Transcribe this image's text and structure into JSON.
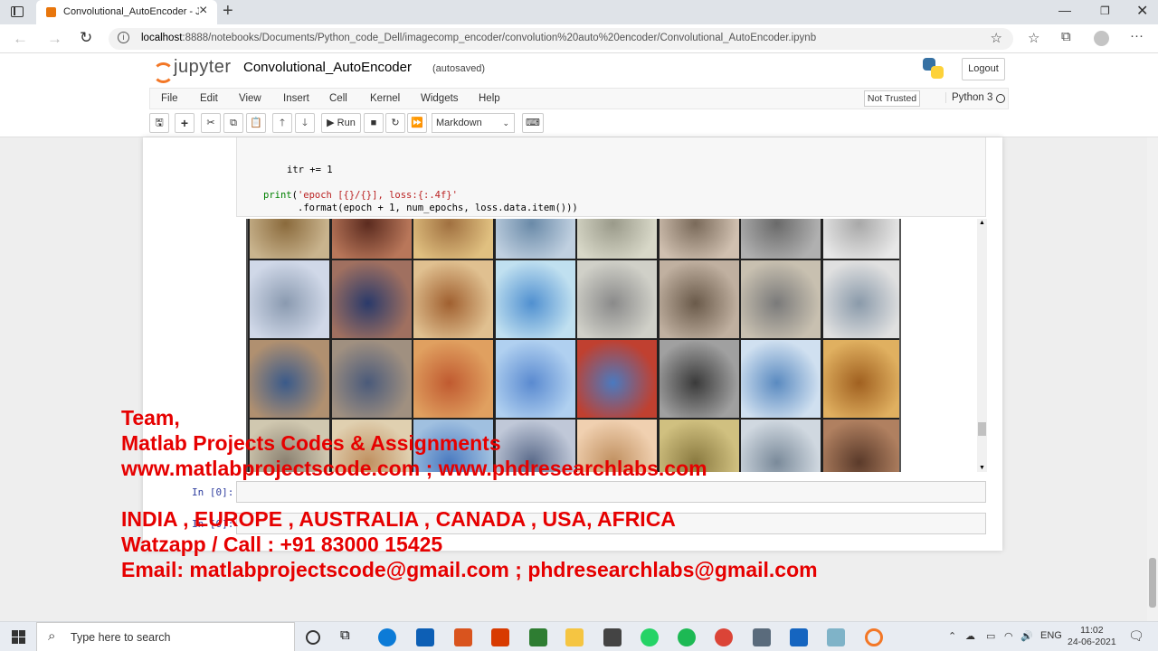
{
  "browser": {
    "tab_title": "Convolutional_AutoEncoder - Ju",
    "url_host": "localhost",
    "url_rest": ":8888/notebooks/Documents/Python_code_Dell/imagecomp_encoder/convolution%20auto%20encoder/Convolutional_AutoEncoder.ipynb"
  },
  "jupyter": {
    "logo_text": "jupyter",
    "notebook_name": "Convolutional_AutoEncoder",
    "save_status": "(autosaved)",
    "logout_label": "Logout",
    "menu": [
      "File",
      "Edit",
      "View",
      "Insert",
      "Cell",
      "Kernel",
      "Widgets",
      "Help"
    ],
    "trust_label": "Not Trusted",
    "kernel_name": "Python 3",
    "toolbar": {
      "run_label": "Run",
      "cell_type": "Markdown"
    }
  },
  "code": {
    "line1": "itr += 1",
    "line2_fn": "print",
    "line2_str": "'epoch [{}/{}], loss:{:.4f}'",
    "line3": ".format(epoch + 1, num_epochs, loss.data.item()))"
  },
  "cells": {
    "prompt1": "In [0]:",
    "prompt2": "In [0]:"
  },
  "overlay": {
    "line1": "Team,",
    "line2": "Matlab Projects Codes & Assignments",
    "line3": "www.matlabprojectscode.com ; www.phdresearchlabs.com",
    "line4": "INDIA , EUROPE , AUSTRALIA , CANADA , USA, AFRICA",
    "line5": "Watzapp / Call : +91 83000 15425",
    "line6": "Email: matlabprojectscode@gmail.com ; phdresearchlabs@gmail.com"
  },
  "taskbar": {
    "search_placeholder": "Type here to search",
    "lang": "ENG",
    "time": "11:02",
    "date": "24-06-2021"
  },
  "colors": {
    "overlay_red": "#e60000",
    "jupyter_orange": "#f37726"
  }
}
